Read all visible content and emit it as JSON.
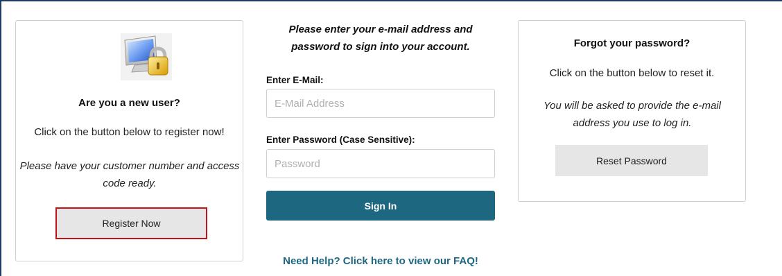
{
  "new_user": {
    "heading": "Are you a new user?",
    "instruction": "Click on the button below to register now!",
    "note": "Please have your customer number and access code ready.",
    "register_label": "Register Now",
    "icon": "computer-lock-icon"
  },
  "signin": {
    "intro": "Please enter your e-mail address and password to sign into your account.",
    "email_label": "Enter E-Mail:",
    "email_placeholder": "E-Mail Address",
    "email_value": "",
    "password_label": "Enter Password (Case Sensitive):",
    "password_placeholder": "Password",
    "password_value": "",
    "signin_label": "Sign In",
    "help_link": "Need Help? Click here to view our FAQ!"
  },
  "forgot": {
    "heading": "Forgot your password?",
    "instruction": "Click on the button below to reset it.",
    "note": "You will be asked to provide the e-mail address you use to log in.",
    "reset_label": "Reset Password"
  },
  "colors": {
    "primary": "#1d6780",
    "highlight": "#c0141a",
    "button_grey": "#e6e6e6"
  }
}
